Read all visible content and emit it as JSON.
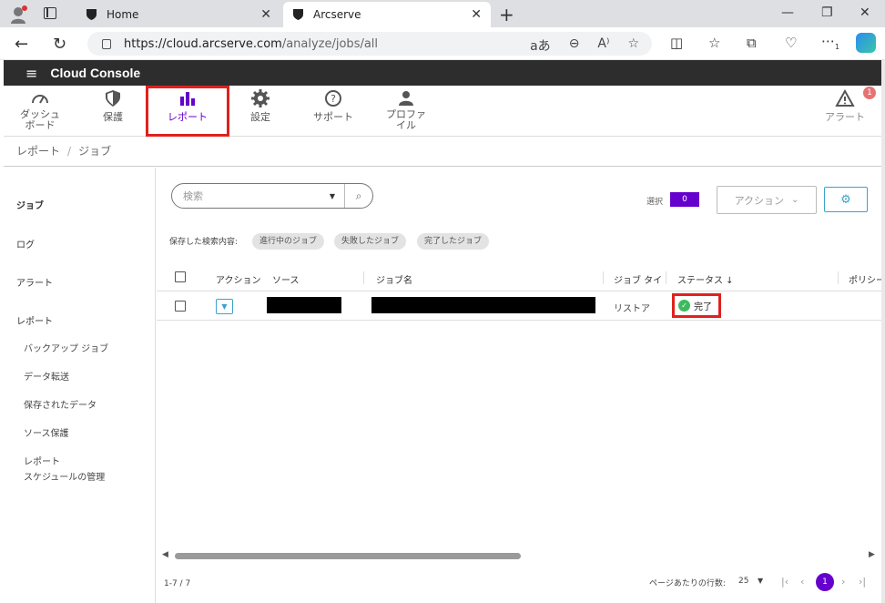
{
  "browser": {
    "tabs": [
      {
        "title": "Home"
      },
      {
        "title": "Arcserve"
      }
    ],
    "url_host": "https://cloud.arcserve.com",
    "url_path": "/analyze/jobs/all",
    "url_tools": [
      "aあ",
      "⊖",
      "A⁾",
      "☆"
    ],
    "toolbar_badge": "1"
  },
  "app": {
    "title": "Cloud Console"
  },
  "nav": {
    "items": [
      {
        "label": "ダッシュ\nボード",
        "icon": "dashboard-icon"
      },
      {
        "label": "保護",
        "icon": "shield-icon"
      },
      {
        "label": "レポート",
        "icon": "bar-chart-icon"
      },
      {
        "label": "設定",
        "icon": "gear-icon"
      },
      {
        "label": "サポート",
        "icon": "help-icon"
      },
      {
        "label": "プロファ\nイル",
        "icon": "person-icon"
      }
    ],
    "alert_label": "アラート",
    "alert_count": "1"
  },
  "breadcrumb": {
    "root": "レポート",
    "sep": "/",
    "current": "ジョブ"
  },
  "sidebar": {
    "items": [
      "ジョブ",
      "ログ",
      "アラート",
      "レポート"
    ],
    "sub_items": [
      "バックアップ ジョブ",
      "データ転送",
      "保存されたデータ",
      "ソース保護",
      "レポート",
      "スケジュールの管理"
    ]
  },
  "toolbar": {
    "search_placeholder": "検索",
    "selection_label": "選択",
    "selection_count": "0",
    "action_label": "アクション"
  },
  "saved_searches": {
    "label": "保存した検索内容:",
    "chips": [
      "進行中のジョブ",
      "失敗したジョブ",
      "完了したジョブ"
    ]
  },
  "table": {
    "columns": [
      "アクション",
      "ソース",
      "ジョブ名",
      "ジョブ タイ",
      "ステータス ↓",
      "ポリシー"
    ],
    "rows": [
      {
        "job_type": "リストア",
        "status": "完了"
      }
    ]
  },
  "footer": {
    "range": "1-7 / 7",
    "per_page_label": "ページあたりの行数:",
    "per_page_value": "25",
    "current_page": "1"
  },
  "colors": {
    "accent": "#6600cc",
    "highlight": "#e0211d",
    "success": "#3dba5e",
    "header_bg": "#2d2d2d"
  }
}
